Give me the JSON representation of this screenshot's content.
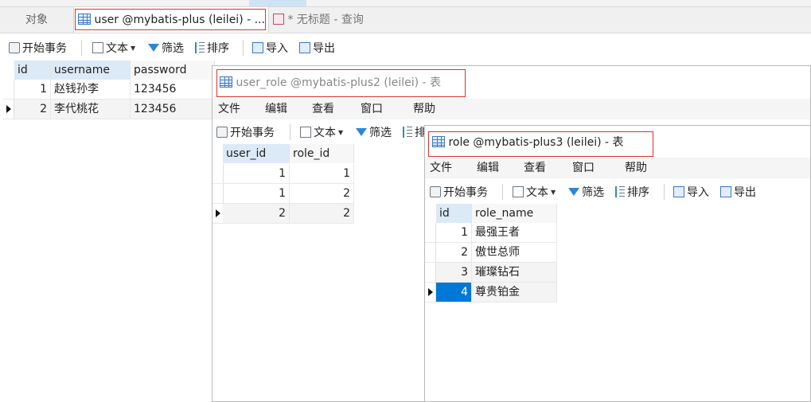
{
  "main": {
    "tabs": [
      {
        "label": "对象"
      },
      {
        "label": "user @mybatis-plus (leilei) - ..."
      },
      {
        "label": "* 无标题 - 查询"
      }
    ],
    "toolbar": {
      "begin_txn": "开始事务",
      "text": "文本",
      "filter": "筛选",
      "sort": "排序",
      "import": "导入",
      "export": "导出"
    },
    "grid": {
      "columns": [
        "id",
        "username",
        "password"
      ],
      "rows": [
        {
          "id": "1",
          "username": "赵钱孙李",
          "password": "123456"
        },
        {
          "id": "2",
          "username": "李代桃花",
          "password": "123456"
        }
      ]
    }
  },
  "user_role_window": {
    "title": "user_role @mybatis-plus2 (leilei) - 表",
    "menu": [
      "文件",
      "编辑",
      "查看",
      "窗口",
      "帮助"
    ],
    "toolbar": {
      "begin_txn": "开始事务",
      "text": "文本",
      "filter": "筛选",
      "sort": "排"
    },
    "grid": {
      "columns": [
        "user_id",
        "role_id"
      ],
      "rows": [
        {
          "user_id": "1",
          "role_id": "1"
        },
        {
          "user_id": "1",
          "role_id": "2"
        },
        {
          "user_id": "2",
          "role_id": "2"
        }
      ]
    }
  },
  "role_window": {
    "title": "role @mybatis-plus3 (leilei) - 表",
    "menu": [
      "文件",
      "编辑",
      "查看",
      "窗口",
      "帮助"
    ],
    "toolbar": {
      "begin_txn": "开始事务",
      "text": "文本",
      "filter": "筛选",
      "sort": "排序",
      "import": "导入",
      "export": "导出"
    },
    "grid": {
      "columns": [
        "id",
        "role_name"
      ],
      "rows": [
        {
          "id": "1",
          "role_name": "最强王者"
        },
        {
          "id": "2",
          "role_name": "傲世总师"
        },
        {
          "id": "3",
          "role_name": "璀璨钻石"
        },
        {
          "id": "4",
          "role_name": "尊贵铂金"
        }
      ]
    }
  },
  "colors": {
    "accent": "#0078d7",
    "highlight_box": "#d9342b",
    "header_bg": "#dce9f7"
  }
}
